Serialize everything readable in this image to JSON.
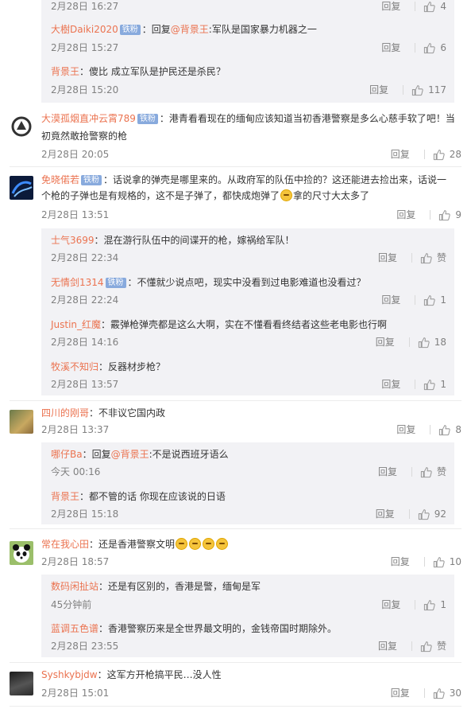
{
  "colors": {
    "name": "#eb7350",
    "meta": "#808080",
    "reply_bg": "#f2f2f5",
    "badge": "#88aadd"
  },
  "ui": {
    "reply_label": "回复",
    "like_label": "赞",
    "badge_label": "铁粉"
  },
  "top_reply_group": [
    {
      "date": "2月28日 16:27",
      "likes": "4"
    },
    {
      "name": "大樹Daiki2020",
      "badge": true,
      "reply_to": "@背景王",
      "text": ":军队是国家暴力机器之一",
      "date": "2月28日 15:27",
      "likes": "6"
    },
    {
      "name": "背景王",
      "text": "：傻比 成立军队是护民还是杀民？",
      "date": "2月28日 15:20",
      "likes": "117"
    }
  ],
  "comments": [
    {
      "name": "大漠孤烟直冲云霄789",
      "badge": true,
      "text_line1": "：港青看看现在的缅甸应该知道当初香港警察是多么心慈手软了吧！当",
      "text_line2": "初竟然敢抢警察的枪",
      "date": "2月28日 20:05",
      "likes": "28",
      "avatar": "circle-logo"
    },
    {
      "name": "免晓偌若",
      "badge": true,
      "text_line1": "：话说拿的弹壳是哪里来的。从政府军的队伍中捡的？这还能进去捡出来，话说一",
      "text_line2a": "个枪的子弹也是有规格的，这不是子弹了，都快成炮弹了",
      "text_line2b": "拿的尺寸大太多了",
      "date": "2月28日 13:51",
      "likes": "9",
      "avatar": "blue-swirl",
      "replies": [
        {
          "name": "士气3699",
          "text": "：混在游行队伍中的间谍开的枪，嫁祸给军队！",
          "date": "2月28日 22:34",
          "likes": "赞"
        },
        {
          "name": "无情剑1314",
          "badge": true,
          "text": "：不懂就少说点吧，现实中没看到过电影难道也没看过？",
          "date": "2月28日 22:24",
          "likes": "1"
        },
        {
          "name": "Justin_红魔",
          "text": "：霰弹枪弹壳都是这么大啊，实在不懂看看终结者这些老电影也行啊",
          "date": "2月28日 14:16",
          "likes": "18"
        },
        {
          "name": "牧溪不知归",
          "text": "：反器材步枪？",
          "date": "2月28日 13:57",
          "likes": "1"
        }
      ]
    },
    {
      "name": "四川的刚哥",
      "text": "：不非议它国内政",
      "date": "2月28日 13:37",
      "likes": "8",
      "avatar": "photo",
      "replies": [
        {
          "name": "哪仔Ba",
          "reply_prefix": "：回复",
          "reply_to": "@背景王",
          "text": ":不是说西班牙语么",
          "date": "今天 00:16",
          "likes": "赞"
        },
        {
          "name": "背景王",
          "text": "：都不管的话 你现在应该说的日语",
          "date": "2月28日 15:18",
          "likes": "92"
        }
      ]
    },
    {
      "name": "常在我心田",
      "text": "：还是香港警察文明",
      "date": "2月28日 18:57",
      "likes": "10",
      "avatar": "panda",
      "replies": [
        {
          "name": "数码闲扯站",
          "text": "：还是有区别的，香港是警，缅甸是军",
          "date": "45分钟前",
          "likes": "1"
        },
        {
          "name": "蓝调五色谱",
          "text": "：香港警察历来是全世界最文明的，金钱帝国时期除外。",
          "date": "2月28日 23:55",
          "likes": "赞"
        }
      ]
    },
    {
      "name": "Syshkybjdw",
      "text": "：这军方开枪搞平民…没人性",
      "date": "2月28日 15:01",
      "likes": "30",
      "avatar": "dark-photo"
    }
  ]
}
